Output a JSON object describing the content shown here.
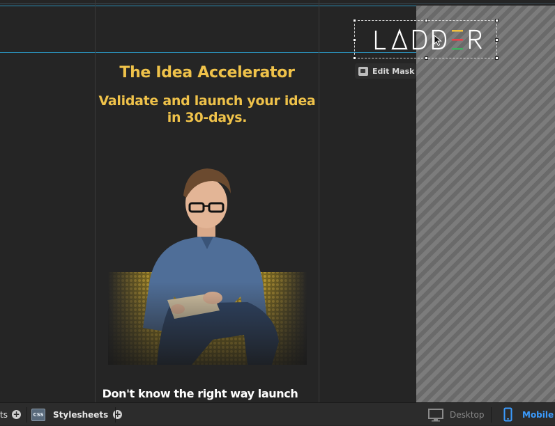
{
  "page": {
    "title_line1": "The Idea Accelerator",
    "title_line2": "Validate and launch your idea in 30-days.",
    "subheading": "Don't know the right way launch",
    "accent_color": "#efc24a"
  },
  "logo": {
    "text": "LADDER",
    "edit_mask_label": "Edit Mask"
  },
  "bottombar": {
    "left_tab_label": "ts",
    "css_badge": "CSS",
    "stylesheets_label": "Stylesheets",
    "desktop_label": "Desktop",
    "mobile_label": "Mobile",
    "active_view": "Mobile",
    "active_color": "#3b9cff"
  },
  "icons": [
    "plus-icon",
    "css-icon",
    "desktop-icon",
    "mobile-icon",
    "edit-mask-icon",
    "cursor-icon"
  ]
}
